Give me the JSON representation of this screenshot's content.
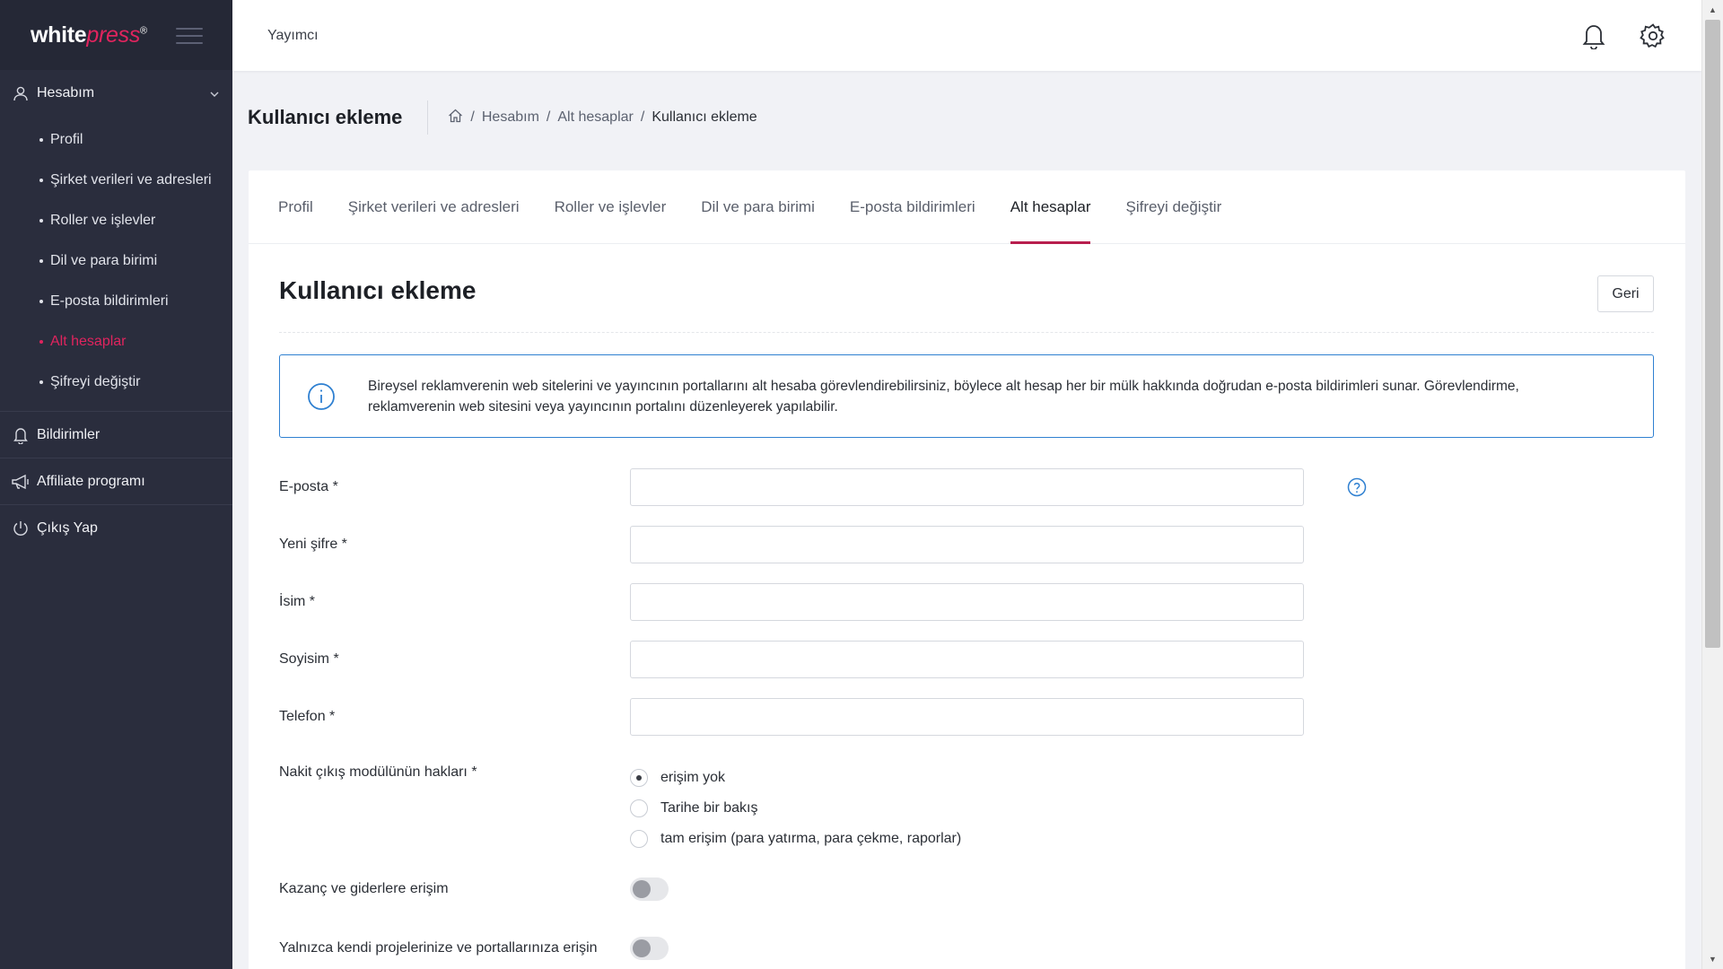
{
  "brand": {
    "white": "white",
    "press": "press",
    "mark": "®"
  },
  "sidebar": {
    "account": {
      "label": "Hesabım",
      "items": [
        {
          "label": "Profil",
          "active": false
        },
        {
          "label": "Şirket verileri ve adresleri",
          "active": false
        },
        {
          "label": "Roller ve işlevler",
          "active": false
        },
        {
          "label": "Dil ve para birimi",
          "active": false
        },
        {
          "label": "E-posta bildirimleri",
          "active": false
        },
        {
          "label": "Alt hesaplar",
          "active": true
        },
        {
          "label": "Şifreyi değiştir",
          "active": false
        }
      ]
    },
    "notifications": {
      "label": "Bildirimler"
    },
    "affiliate": {
      "label": "Affiliate programı"
    },
    "logout": {
      "label": "Çıkış Yap"
    }
  },
  "topbar": {
    "role": "Yayımcı"
  },
  "header": {
    "title": "Kullanıcı ekleme",
    "breadcrumb": [
      "Hesabım",
      "Alt hesaplar",
      "Kullanıcı ekleme"
    ]
  },
  "tabs": [
    {
      "label": "Profil",
      "active": false
    },
    {
      "label": "Şirket verileri ve adresleri",
      "active": false
    },
    {
      "label": "Roller ve işlevler",
      "active": false
    },
    {
      "label": "Dil ve para birimi",
      "active": false
    },
    {
      "label": "E-posta bildirimleri",
      "active": false
    },
    {
      "label": "Alt hesaplar",
      "active": true
    },
    {
      "label": "Şifreyi değiştir",
      "active": false
    }
  ],
  "card": {
    "title": "Kullanıcı ekleme",
    "back_label": "Geri",
    "info_text": "Bireysel reklamverenin web sitelerini ve yayıncının portallarını alt hesaba görevlendirebilirsiniz, böylece alt hesap her bir mülk hakkında doğrudan e-posta bildirimleri sunar. Görevlendirme, reklamverenin web sitesini veya yayıncının portalını düzenleyerek yapılabilir."
  },
  "form": {
    "email": {
      "label": "E-posta *",
      "value": ""
    },
    "password": {
      "label": "Yeni şifre *",
      "value": ""
    },
    "name": {
      "label": "İsim *",
      "value": ""
    },
    "surname": {
      "label": "Soyisim *",
      "value": ""
    },
    "phone": {
      "label": "Telefon *",
      "value": ""
    },
    "cashout": {
      "label": "Nakit çıkış modülünün hakları *",
      "options": [
        {
          "label": "erişim yok",
          "checked": true
        },
        {
          "label": "Tarihe bir bakış",
          "checked": false
        },
        {
          "label": "tam erişim (para yatırma, para çekme, raporlar)",
          "checked": false
        }
      ]
    },
    "earnings_access": {
      "label": "Kazanç ve giderlere erişim",
      "enabled": false
    },
    "own_projects_access": {
      "label": "Yalnızca kendi projelerinize ve portallarınıza erişin",
      "enabled": false
    }
  },
  "colors": {
    "accent": "#e0245e",
    "tab_underline": "#b81e4e",
    "info_border": "#2f80d1",
    "sidebar_bg": "#2a2d3d"
  },
  "icons": [
    "menu-icon",
    "user-icon",
    "chevron-down-icon",
    "bell-icon",
    "megaphone-icon",
    "power-icon",
    "gear-icon",
    "home-icon",
    "info-icon",
    "help-icon"
  ]
}
